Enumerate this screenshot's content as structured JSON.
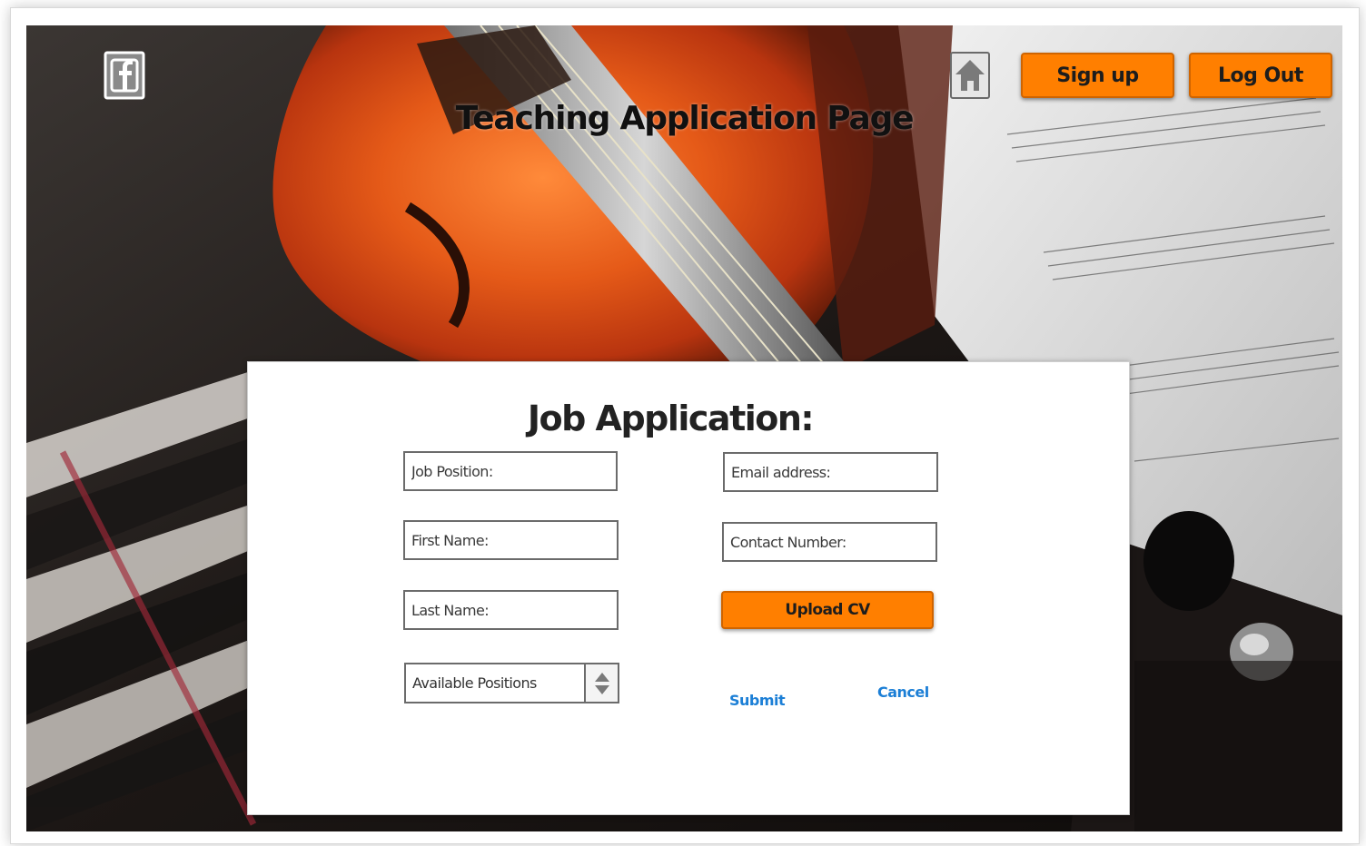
{
  "header": {
    "title": "Teaching Application Page",
    "signup_label": "Sign up",
    "logout_label": "Log Out"
  },
  "icons": {
    "social": "facebook-icon",
    "home": "home-icon"
  },
  "form": {
    "title": "Job Application:",
    "fields": {
      "job_position": {
        "placeholder": "Job Position:",
        "value": ""
      },
      "first_name": {
        "placeholder": "First Name:",
        "value": ""
      },
      "last_name": {
        "placeholder": "Last Name:",
        "value": ""
      },
      "email": {
        "placeholder": "Email address:",
        "value": ""
      },
      "contact_number": {
        "placeholder": "Contact Number:",
        "value": ""
      }
    },
    "positions_select": {
      "selected": "Available Positions"
    },
    "upload_label": "Upload CV",
    "submit_label": "Submit",
    "cancel_label": "Cancel"
  },
  "colors": {
    "accent": "#ff7f00",
    "link": "#1c7fd6",
    "title_text": "#111111"
  }
}
